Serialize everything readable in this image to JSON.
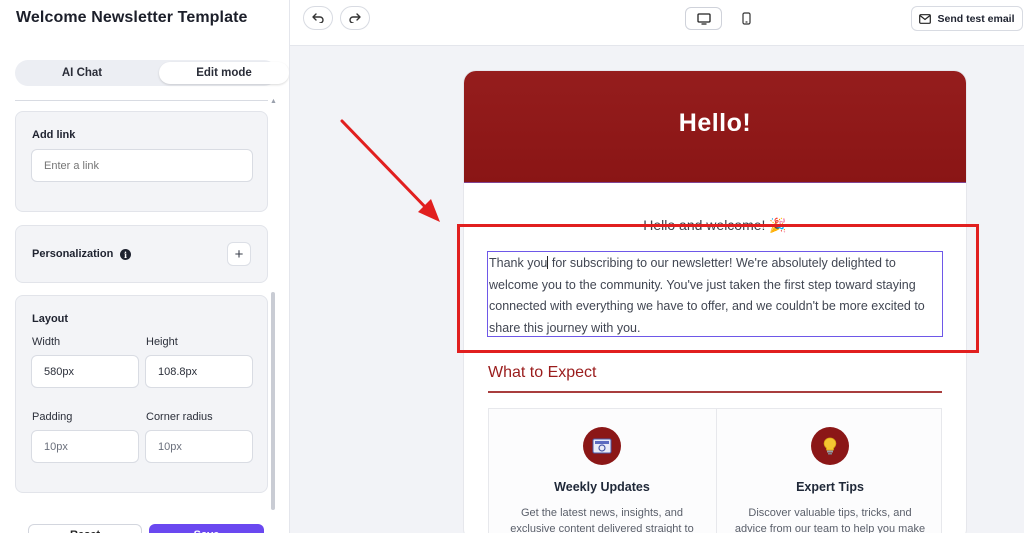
{
  "sidebar": {
    "title": "Welcome Newsletter Template",
    "modes": {
      "ai_chat": "AI Chat",
      "edit_mode": "Edit mode",
      "active": "Edit mode"
    },
    "add_link": {
      "label": "Add link",
      "placeholder": "Enter a link"
    },
    "personalization": {
      "label": "Personalization",
      "info_icon": "i"
    },
    "layout": {
      "label": "Layout",
      "width_label": "Width",
      "width_value": "580px",
      "height_label": "Height",
      "height_value": "108.8px",
      "padding_label": "Padding",
      "padding_value": "10px",
      "radius_label": "Corner radius",
      "radius_value": "10px"
    },
    "footer": {
      "reset_label": "Reset",
      "save_label": "Save"
    }
  },
  "toolbar": {
    "undo_icon": "undo-icon",
    "redo_icon": "redo-icon",
    "desktop_icon": "monitor-icon",
    "mobile_icon": "phone-icon",
    "send_label": "Send test email"
  },
  "email": {
    "hero_title": "Hello!",
    "hero_color": "#8f1a1a",
    "welcome_line": "Hello and welcome! 🎉",
    "body_before_caret": "Thank you",
    "body_after_caret": " for subscribing to our newsletter! We're absolutely delighted to welcome you to the community. You've just taken the first step toward staying connected with everything we have to offer, and we couldn't be more excited to share this journey with you.",
    "section_title": "What to Expect",
    "features": [
      {
        "icon": "newspaper-icon",
        "title": "Weekly Updates",
        "desc": "Get the latest news, insights, and exclusive content delivered straight to"
      },
      {
        "icon": "lightbulb-icon",
        "title": "Expert Tips",
        "desc": "Discover valuable tips, tricks, and advice from our team to help you make the"
      }
    ]
  },
  "colors": {
    "accent_purple": "#6a48f0",
    "annotation_red": "#e11f1f",
    "brand_red": "#9a1c1c"
  }
}
